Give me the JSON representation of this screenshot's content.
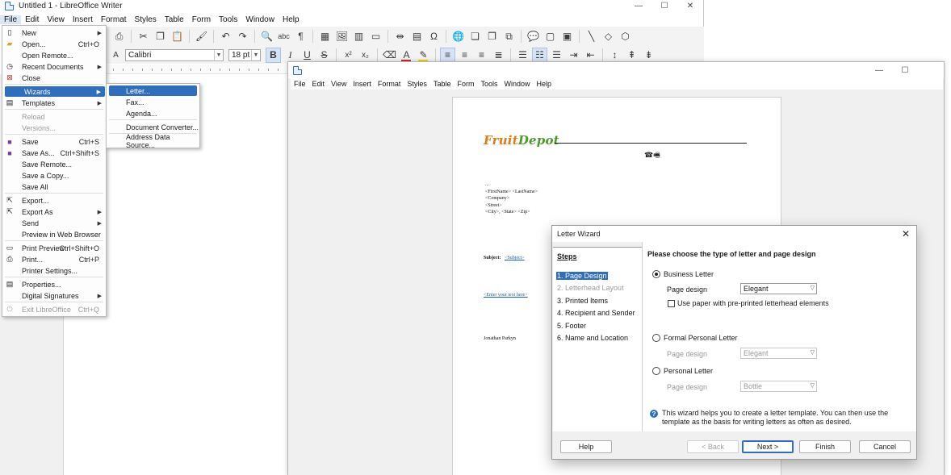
{
  "window1": {
    "title": "Untitled 1 - LibreOffice Writer",
    "menus": [
      "File",
      "Edit",
      "View",
      "Insert",
      "Format",
      "Styles",
      "Table",
      "Form",
      "Tools",
      "Window",
      "Help"
    ],
    "font_name": "Calibri",
    "font_size": "18 pt"
  },
  "file_menu": {
    "items": [
      {
        "label": "New",
        "shortcut": "",
        "submenu": true,
        "icon": "new-doc-icon"
      },
      {
        "label": "Open...",
        "shortcut": "Ctrl+O",
        "icon": "folder-icon"
      },
      {
        "label": "Open Remote...",
        "shortcut": ""
      },
      {
        "label": "Recent Documents",
        "shortcut": "",
        "submenu": true,
        "icon": "clock-icon"
      },
      {
        "label": "Close",
        "shortcut": "",
        "icon": "close-doc-icon"
      },
      {
        "label": "Wizards",
        "shortcut": "",
        "submenu": true,
        "selected": true
      },
      {
        "label": "Templates",
        "shortcut": "",
        "submenu": true,
        "icon": "templates-icon"
      },
      {
        "label": "Reload",
        "shortcut": "",
        "disabled": true
      },
      {
        "label": "Versions...",
        "shortcut": "",
        "disabled": true
      },
      {
        "label": "Save",
        "shortcut": "Ctrl+S",
        "icon": "save-icon"
      },
      {
        "label": "Save As...",
        "shortcut": "Ctrl+Shift+S",
        "icon": "save-as-icon"
      },
      {
        "label": "Save Remote...",
        "shortcut": ""
      },
      {
        "label": "Save a Copy...",
        "shortcut": ""
      },
      {
        "label": "Save All",
        "shortcut": ""
      },
      {
        "label": "Export...",
        "shortcut": "",
        "icon": "export-icon"
      },
      {
        "label": "Export As",
        "shortcut": "",
        "submenu": true,
        "icon": "export-as-icon"
      },
      {
        "label": "Send",
        "shortcut": "",
        "submenu": true
      },
      {
        "label": "Preview in Web Browser",
        "shortcut": ""
      },
      {
        "label": "Print Preview",
        "shortcut": "Ctrl+Shift+O",
        "icon": "print-preview-icon"
      },
      {
        "label": "Print...",
        "shortcut": "Ctrl+P",
        "icon": "printer-icon"
      },
      {
        "label": "Printer Settings...",
        "shortcut": ""
      },
      {
        "label": "Properties...",
        "shortcut": "",
        "icon": "properties-icon"
      },
      {
        "label": "Digital Signatures",
        "shortcut": "",
        "submenu": true
      },
      {
        "label": "Exit LibreOffice",
        "shortcut": "Ctrl+Q",
        "disabled": true,
        "icon": "power-icon"
      }
    ]
  },
  "wizards_menu": {
    "items": [
      "Letter...",
      "Fax...",
      "Agenda...",
      "Document Converter...",
      "Address Data Source..."
    ]
  },
  "window2": {
    "menus": [
      "File",
      "Edit",
      "View",
      "Insert",
      "Format",
      "Styles",
      "Table",
      "Form",
      "Tools",
      "Window",
      "Help"
    ],
    "letter": {
      "logo": {
        "part1": "Fruit",
        "part2": "Depot"
      },
      "dots": "...",
      "address_lines": [
        "<FirstName> <LastName>",
        "<Company>",
        "<Street>",
        "<City>, <State> <Zip>"
      ],
      "subject_label": "Subject:",
      "subject_field": "<Subject>",
      "body_field": "<Enter your text here>",
      "signature": "Jonathan Parkyn"
    }
  },
  "dialog": {
    "title": "Letter Wizard",
    "steps_header": "Steps",
    "steps": [
      {
        "label": "1. Page Design",
        "selected": true
      },
      {
        "label": "2. Letterhead Layout",
        "disabled": true
      },
      {
        "label": "3. Printed Items"
      },
      {
        "label": "4. Recipient and Sender"
      },
      {
        "label": "5. Footer"
      },
      {
        "label": "6. Name and Location"
      }
    ],
    "header": "Please choose the type of letter and page design",
    "options": [
      {
        "label": "Business Letter",
        "checked": true,
        "page_design_label": "Page design",
        "page_design": "Elegant",
        "enabled": true
      },
      {
        "label": "Formal Personal Letter",
        "checked": false,
        "page_design_label": "Page design",
        "page_design": "Elegant",
        "enabled": false
      },
      {
        "label": "Personal Letter",
        "checked": false,
        "page_design_label": "Page design",
        "page_design": "Bottle",
        "enabled": false
      }
    ],
    "letterhead_checkbox": "Use paper with pre-printed letterhead elements",
    "info_line1": "This wizard helps you to create a letter template. You can then use the",
    "info_line2": "template as the basis for writing letters as often as desired.",
    "buttons": {
      "help": "Help",
      "back": "< Back",
      "next": "Next >",
      "finish": "Finish",
      "cancel": "Cancel"
    }
  },
  "colors": {
    "accent": "#2f6dbf",
    "font_color_bar": "#d22a2a",
    "highlight_bar": "#f5d400"
  }
}
